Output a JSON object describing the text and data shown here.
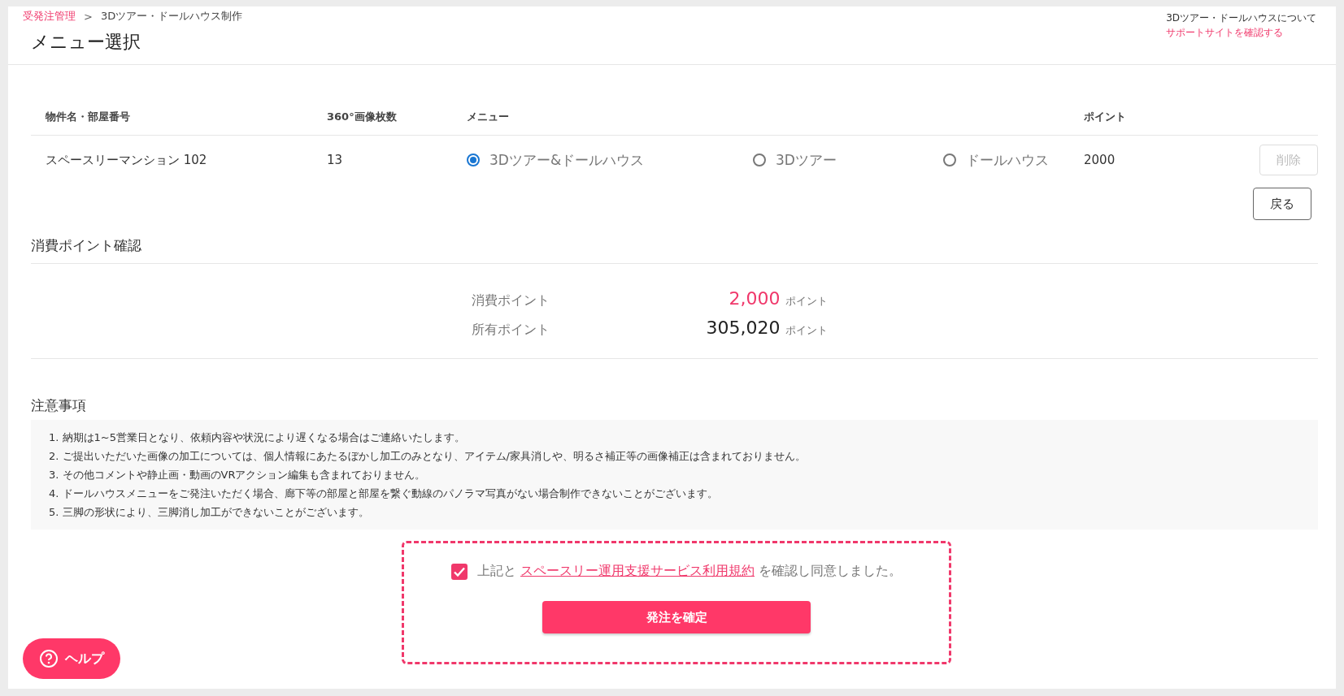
{
  "breadcrumb": [
    {
      "label": "受発注管理",
      "link": true
    },
    {
      "label": "3Dツアー・ドールハウス制作",
      "link": false
    }
  ],
  "breadcrumb_separator": ">",
  "title": "メニュー選択",
  "support": {
    "text": "3Dツアー・ドールハウスについて",
    "link": "サポートサイトを確認する"
  },
  "table": {
    "columns": [
      "物件名・部屋番号",
      "360°画像枚数",
      "メニュー",
      "ポイント"
    ],
    "rows": [
      {
        "name": "スペースリーマンション 102",
        "images": "13",
        "options": [
          {
            "label": "3Dツアー&ドールハウス",
            "selected": true
          },
          {
            "label": "3Dツアー",
            "selected": false
          },
          {
            "label": "ドールハウス",
            "selected": false
          }
        ],
        "points": "2000",
        "delete": {
          "label": "削除",
          "disabled": true
        }
      }
    ]
  },
  "back_button": "戻る",
  "points_section": {
    "title": "消費ポイント確認",
    "rows": [
      {
        "label": "消費ポイント",
        "value": "2,000",
        "unit": "ポイント",
        "highlight": true
      },
      {
        "label": "所有ポイント",
        "value": "305,020",
        "unit": "ポイント",
        "highlight": false
      }
    ]
  },
  "notes": {
    "title": "注意事項",
    "items": [
      "1. 納期は1~5営業日となり、依頼内容や状況により遅くなる場合はご連絡いたします。",
      "2. ご提出いただいた画像の加工については、個人情報にあたるぼかし加工のみとなり、アイテム/家具消しや、明るさ補正等の画像補正は含まれておりません。",
      "3. その他コメントや静止画・動画のVRアクション編集も含まれておりません。",
      "4. ドールハウスメニューをご発注いただく場合、廊下等の部屋と部屋を繋ぐ動線のパノラマ写真がない場合制作できないことがございます。",
      "5. 三脚の形状により、三脚消し加工ができないことがございます。"
    ]
  },
  "agreement": {
    "checked": true,
    "before": "上記と",
    "link": "スペースリー運用支援サービス利用規約",
    "after": "を確認し同意しました。"
  },
  "confirm_button": "発注を確定",
  "help_button": "ヘルプ"
}
